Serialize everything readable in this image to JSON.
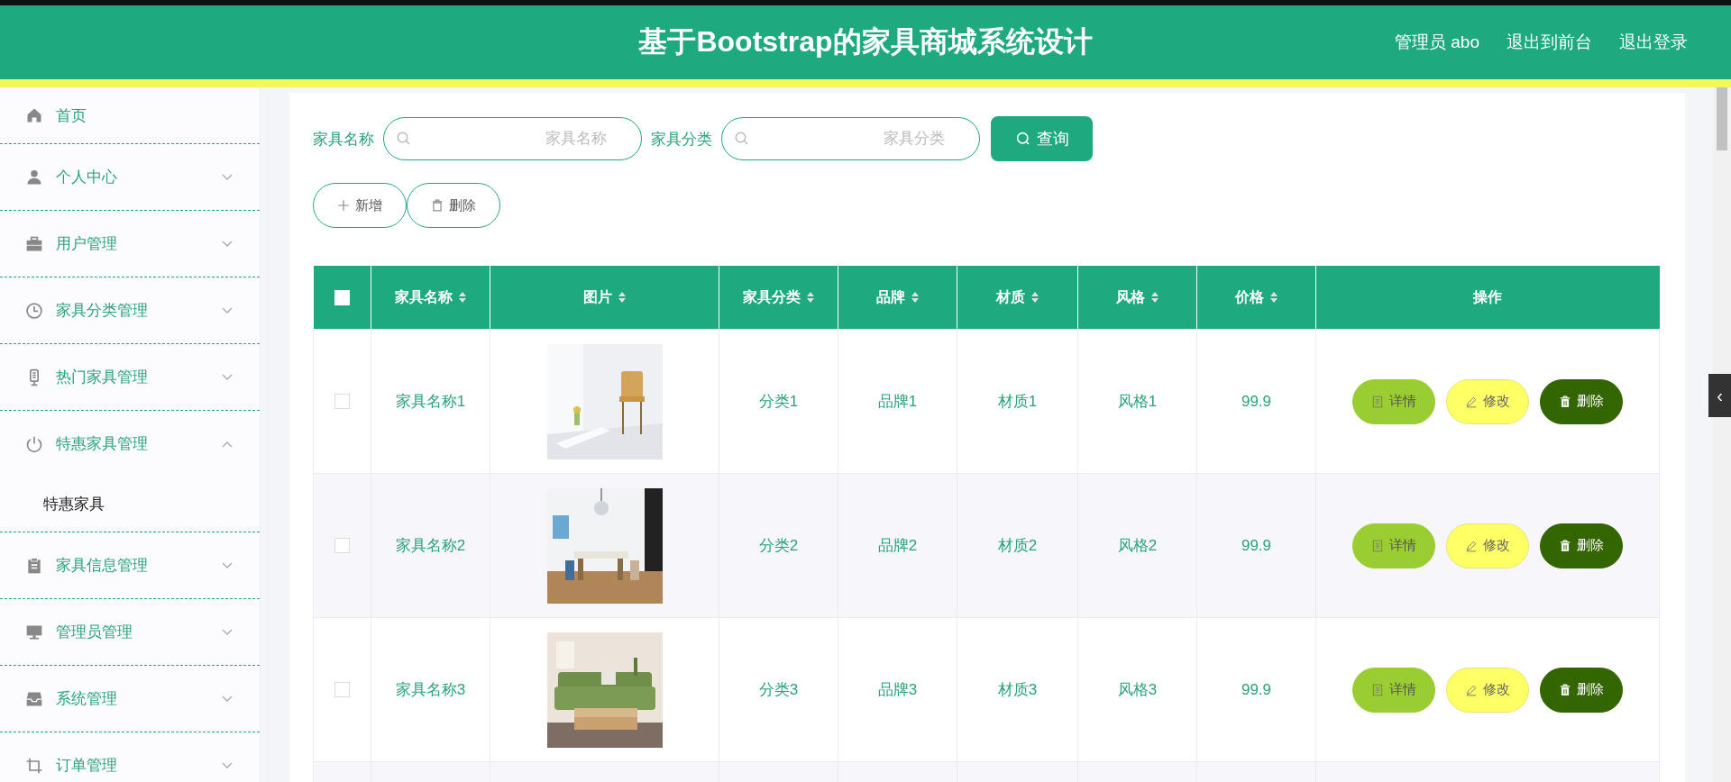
{
  "header": {
    "title": "基于Bootstrap的家具商城系统设计",
    "links": [
      "管理员 abo",
      "退出到前台",
      "退出登录"
    ]
  },
  "sidebar": {
    "items": [
      {
        "label": "首页",
        "kind": "link"
      },
      {
        "label": "个人中心",
        "kind": "menu",
        "expanded": false
      },
      {
        "label": "用户管理",
        "kind": "menu",
        "expanded": false
      },
      {
        "label": "家具分类管理",
        "kind": "menu",
        "expanded": false
      },
      {
        "label": "热门家具管理",
        "kind": "menu",
        "expanded": false
      },
      {
        "label": "特惠家具管理",
        "kind": "menu",
        "expanded": true,
        "children": [
          {
            "label": "特惠家具"
          }
        ]
      },
      {
        "label": "家具信息管理",
        "kind": "menu",
        "expanded": false
      },
      {
        "label": "管理员管理",
        "kind": "menu",
        "expanded": false
      },
      {
        "label": "系统管理",
        "kind": "menu",
        "expanded": false
      },
      {
        "label": "订单管理",
        "kind": "menu",
        "expanded": false
      }
    ]
  },
  "search": {
    "fields": [
      {
        "label": "家具名称",
        "placeholder": "家具名称"
      },
      {
        "label": "家具分类",
        "placeholder": "家具分类"
      }
    ],
    "button": "查询"
  },
  "toolbar": {
    "buttons": [
      {
        "label": "新增",
        "kind": "add"
      },
      {
        "label": "删除",
        "kind": "delete"
      }
    ]
  },
  "table": {
    "select_all_checked": false,
    "columns": [
      {
        "label": "家具名称",
        "sortable": true
      },
      {
        "label": "图片",
        "sortable": true
      },
      {
        "label": "家具分类",
        "sortable": true
      },
      {
        "label": "品牌",
        "sortable": true
      },
      {
        "label": "材质",
        "sortable": true
      },
      {
        "label": "风格",
        "sortable": true
      },
      {
        "label": "价格",
        "sortable": true
      },
      {
        "label": "操作",
        "sortable": false
      }
    ],
    "rows": [
      {
        "selected": false,
        "name": "家具名称1",
        "category": "分类1",
        "brand": "品牌1",
        "material": "材质1",
        "style": "风格1",
        "price": "99.9",
        "actions": [
          {
            "label": "详情",
            "kind": "detail"
          },
          {
            "label": "修改",
            "kind": "edit"
          },
          {
            "label": "删除",
            "kind": "delete"
          }
        ]
      },
      {
        "selected": false,
        "name": "家具名称2",
        "category": "分类2",
        "brand": "品牌2",
        "material": "材质2",
        "style": "风格2",
        "price": "99.9",
        "actions": [
          {
            "label": "详情",
            "kind": "detail"
          },
          {
            "label": "修改",
            "kind": "edit"
          },
          {
            "label": "删除",
            "kind": "delete"
          }
        ]
      },
      {
        "selected": false,
        "name": "家具名称3",
        "category": "分类3",
        "brand": "品牌3",
        "material": "材质3",
        "style": "风格3",
        "price": "99.9",
        "actions": [
          {
            "label": "详情",
            "kind": "detail"
          },
          {
            "label": "修改",
            "kind": "edit"
          },
          {
            "label": "删除",
            "kind": "delete"
          }
        ]
      }
    ]
  },
  "side_tab": "‹"
}
